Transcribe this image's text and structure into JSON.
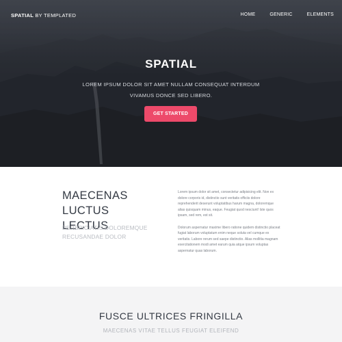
{
  "nav": {
    "brand_bold": "SPATIAL",
    "brand_rest": "BY TEMPLATED",
    "links": [
      "HOME",
      "GENERIC",
      "ELEMENTS"
    ]
  },
  "hero": {
    "title": "SPATIAL",
    "subtitle": "LOREM IPSUM DOLOR SIT AMET NULLAM CONSEQUAT INTERDUM VIVAMUS DONCE SED LIBERO.",
    "cta_label": "GET STARTED",
    "cta_color": "#ed4a6a"
  },
  "intro": {
    "heading": "MAECENAS LUCTUS LECTUS",
    "subheading": "PERSPICIATIS DOLOREMQUE RECUSANDAE DOLOR",
    "paragraphs": [
      "Lorem ipsum dolor sit amet, consectetur adipisicing elit. Non ex dolore corporis id, distinctio sunt veritatis officiis dolore reprehenderit deserunt voluptatibus harum magna, doloremque alias quisquam minus, eaque. Feugiat quod nesciunt! Iste quos ipsam, sed rem, est sit.",
      "Dolorum aspernatur maxime libero ratione quidem distinctio placeat fugiat laborum voluptatum enim neque soluta vel cumque ex veritatis. Labore rerum sed saepe distinctio. Alias mollitia magnam exercitationem modi amet earum quia atque ipsum voluptas aspernatur quas laborum."
    ]
  },
  "features": {
    "title": "FUSCE ULTRICES FRINGILLA",
    "subtitle": "MAECENAS VITAE TELLUS FEUGIAT ELEIFEND"
  }
}
